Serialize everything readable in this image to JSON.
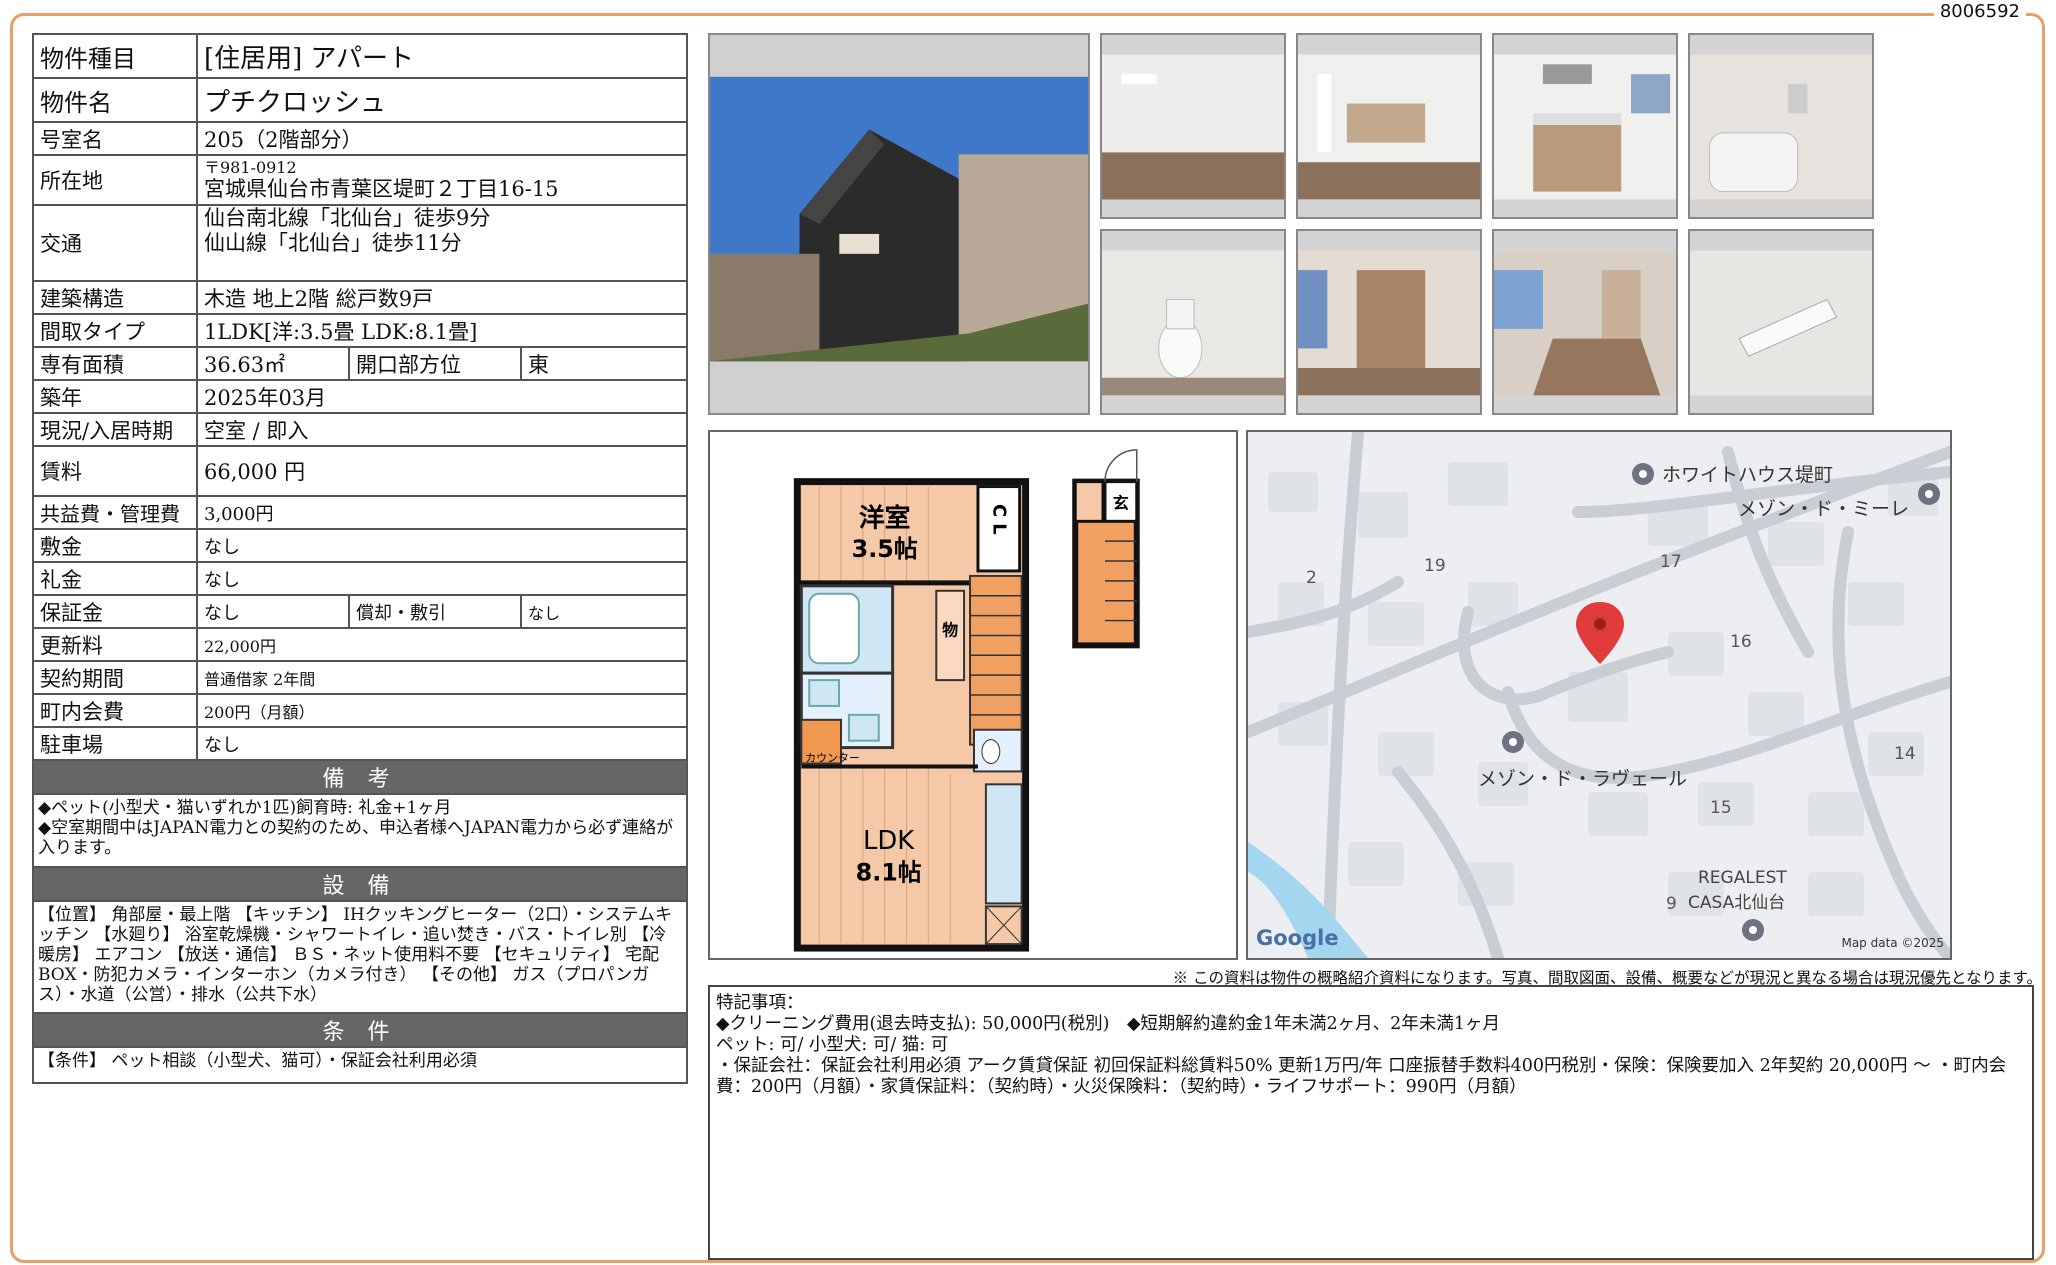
{
  "doc_no": "8006592",
  "spec": {
    "type_label": "物件種目",
    "type_value": "[住居用] アパート",
    "name_label": "物件名",
    "name_value": "プチクロッシュ",
    "room_label": "号室名",
    "room_value": "205（2階部分）",
    "addr_label": "所在地",
    "addr_zip": "〒981-0912",
    "addr_value": "宮城県仙台市青葉区堤町２丁目16-15",
    "access_label": "交通",
    "access_1": "仙台南北線「北仙台」徒歩9分",
    "access_2": "仙山線「北仙台」徒歩11分",
    "struct_label": "建築構造",
    "struct_value": "木造 地上2階 総戸数9戸",
    "layout_label": "間取タイプ",
    "layout_value": "1LDK[洋:3.5畳 LDK:8.1畳]",
    "area_label": "専有面積",
    "area_value": "36.63㎡",
    "dir_label": "開口部方位",
    "dir_value": "東",
    "built_label": "築年",
    "built_value": "2025年03月",
    "status_label": "現況/入居時期",
    "status_value": "空室 / 即入",
    "rent_label": "賃料",
    "rent_value": "66,000 円",
    "fee_label": "共益費・管理費",
    "fee_value": "3,000円",
    "deposit_label": "敷金",
    "deposit_value": "なし",
    "key_label": "礼金",
    "key_value": "なし",
    "guarantee_label": "保証金",
    "guarantee_value": "なし",
    "amort_label": "償却・敷引",
    "amort_value": "なし",
    "renew_label": "更新料",
    "renew_value": "22,000円",
    "contract_label": "契約期間",
    "contract_value": "普通借家 2年間",
    "town_label": "町内会費",
    "town_value": "200円（月額）",
    "parking_label": "駐車場",
    "parking_value": "なし"
  },
  "remarks_head": "備 考",
  "remarks_text": "◆ペット(小型犬・猫いずれか1匹)飼育時: 礼金+1ヶ月\n◆空室期間中はJAPAN電力との契約のため、申込者様へJAPAN電力から必ず連絡が入ります。",
  "equip_head": "設 備",
  "equip_text": "【位置】 角部屋・最上階 【キッチン】 IHクッキングヒーター（2口）・システムキッチン 【水廻り】 浴室乾燥機・シャワートイレ・追い焚き・バス・トイレ別 【冷暖房】 エアコン 【放送・通信】 ＢＳ・ネット使用料不要 【セキュリティ】 宅配BOX・防犯カメラ・インターホン（カメラ付き） 【その他】 ガス（プロパンガス）・水道（公営）・排水（公共下水）",
  "cond_head": "条 件",
  "cond_text": "【条件】 ペット相談（小型犬、猫可）・保証会社利用必須",
  "plan": {
    "room1": "洋室",
    "room1_size": "3.5帖",
    "cl": "C L",
    "storage": "物",
    "entrance": "玄",
    "counter": "カウンター",
    "ldk": "LDK",
    "ldk_size": "8.1帖"
  },
  "map": {
    "poi_1": "ホワイトハウス堤町",
    "poi_2": "メゾン・ド・ミーレ",
    "poi_3": "メゾン・ド・ラヴェール",
    "poi_4": "REGALEST",
    "poi_5": "CASA北仙台",
    "num_2": "2",
    "num_19": "19",
    "num_17": "17",
    "num_16": "16",
    "num_14": "14",
    "num_15": "15",
    "num_9": "9",
    "google": "Google",
    "copyright": "Map data ©2025"
  },
  "disclaimer": "※ この資料は物件の概略紹介資料になります。写真、間取図面、設備、概要などが現況と異なる場合は現況優先となります。",
  "special": {
    "title": "特記事項：",
    "line1": "◆クリーニング費用(退去時支払): 50,000円(税別)　◆短期解約違約金1年未満2ヶ月、2年未満1ヶ月",
    "line2": "ペット: 可/ 小型犬: 可/ 猫: 可",
    "line3": "・保証会社：保証会社利用必須 アーク賃貸保証 初回保証料総賃料50% 更新1万円/年 口座振替手数料400円税別・保険：保険要加入 2年契約 20,000円 〜 ・町内会費：200円（月額）・家賃保証料：（契約時）・火災保険料：（契約時）・ライフサポート：990円（月額）"
  },
  "colors": {
    "frame": "#e8a068",
    "section_head": "#666666",
    "plan_room": "#f5c9a8",
    "map_pin": "#e03c3c"
  }
}
